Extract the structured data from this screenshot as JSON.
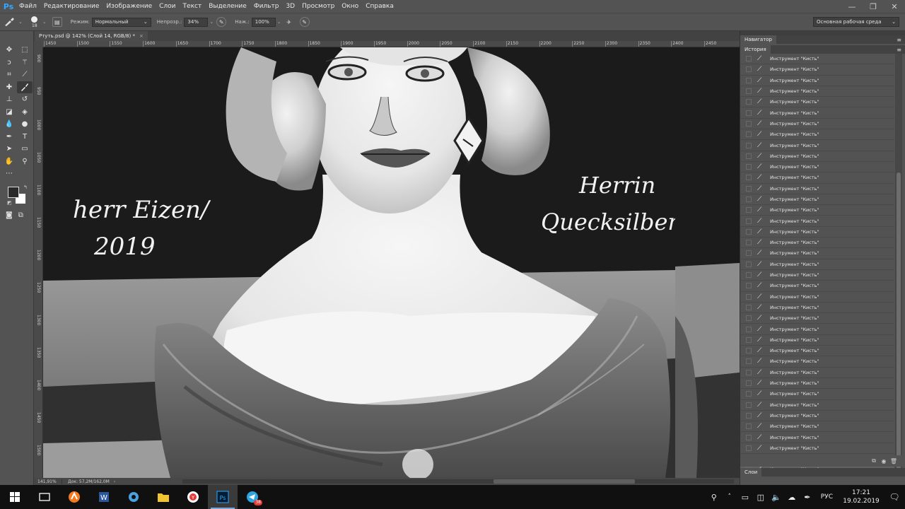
{
  "app": {
    "logo": "Ps"
  },
  "menubar": {
    "items": [
      "Файл",
      "Редактирование",
      "Изображение",
      "Слои",
      "Текст",
      "Выделение",
      "Фильтр",
      "3D",
      "Просмотр",
      "Окно",
      "Справка"
    ]
  },
  "window_controls": {
    "minimize": "—",
    "restore": "❐",
    "close": "✕"
  },
  "options": {
    "brush_size": "18",
    "mode_label": "Режим:",
    "mode_value": "Нормальный",
    "opacity_label": "Непрозр.:",
    "opacity_value": "34%",
    "flow_label": "Наж.:",
    "flow_value": "100%",
    "workspace": "Основная рабочая среда"
  },
  "document": {
    "tab_title": "Ртуть.psd @ 142% (Слой 14, RGB/8) *",
    "tab_close": "×"
  },
  "ruler": {
    "h_labels": [
      "1450",
      "1500",
      "1550",
      "1600",
      "1650",
      "1700",
      "1750",
      "1800",
      "1850",
      "1900",
      "1950",
      "2000",
      "2050",
      "2100",
      "2150",
      "2200",
      "2250",
      "2300",
      "2350",
      "2400",
      "2450"
    ],
    "v_labels": [
      "900",
      "950",
      "1000",
      "1050",
      "1100",
      "1150",
      "1200",
      "1250",
      "1300",
      "1350",
      "1400",
      "1450",
      "1500"
    ]
  },
  "artwork": {
    "signature_left_line1": "herr Eizen/",
    "signature_left_line2": "2019",
    "signature_right_line1": "Herrin",
    "signature_right_line2": "Quecksilber"
  },
  "status": {
    "zoom": "141,91%",
    "doc": "Док: 57,2М/162,0М"
  },
  "panels": {
    "navigator_title": "Навигатор",
    "history_title": "История",
    "layers_title": "Слои",
    "menu_glyph": "≡",
    "history_items": [
      "Инструмент \"Кисть\"",
      "Инструмент \"Кисть\"",
      "Инструмент \"Кисть\"",
      "Инструмент \"Кисть\"",
      "Инструмент \"Кисть\"",
      "Инструмент \"Кисть\"",
      "Инструмент \"Кисть\"",
      "Инструмент \"Кисть\"",
      "Инструмент \"Кисть\"",
      "Инструмент \"Кисть\"",
      "Инструмент \"Кисть\"",
      "Инструмент \"Кисть\"",
      "Инструмент \"Кисть\"",
      "Инструмент \"Кисть\"",
      "Инструмент \"Кисть\"",
      "Инструмент \"Кисть\"",
      "Инструмент \"Кисть\"",
      "Инструмент \"Кисть\"",
      "Инструмент \"Кисть\"",
      "Инструмент \"Кисть\"",
      "Инструмент \"Кисть\"",
      "Инструмент \"Кисть\"",
      "Инструмент \"Кисть\"",
      "Инструмент \"Кисть\"",
      "Инструмент \"Кисть\"",
      "Инструмент \"Кисть\"",
      "Инструмент \"Кисть\"",
      "Инструмент \"Кисть\"",
      "Инструмент \"Кисть\"",
      "Инструмент \"Кисть\"",
      "Инструмент \"Кисть\"",
      "Инструмент \"Кисть\"",
      "Инструмент \"Кисть\"",
      "Инструмент \"Кисть\"",
      "Инструмент \"Кисть\"",
      "Инструмент \"Кисть\"",
      "Инструмент \"Кисть\"",
      "Инструмент \"Кисть\"",
      "Инструмент \"Кисть\""
    ]
  },
  "tools": [
    "move-tool",
    "marquee-tool",
    "lasso-tool",
    "magic-wand-tool",
    "crop-tool",
    "eyedropper-tool",
    "healing-tool",
    "brush-tool",
    "stamp-tool",
    "history-brush-tool",
    "eraser-tool",
    "gradient-tool",
    "blur-tool",
    "dodge-tool",
    "pen-tool",
    "type-tool",
    "path-select-tool",
    "shape-tool",
    "hand-tool",
    "zoom-tool"
  ],
  "taskbar": {
    "apps": [
      "start",
      "task-view",
      "avast",
      "word",
      "settings",
      "explorer",
      "yandex",
      "photoshop",
      "telegram"
    ],
    "telegram_badge": "38",
    "lang": "РУС",
    "time": "17:21",
    "date": "19.02.2019"
  },
  "colors": {
    "accent": "#31a8ff",
    "panel": "#535353",
    "canvas_bg": "#1a1a1a"
  }
}
